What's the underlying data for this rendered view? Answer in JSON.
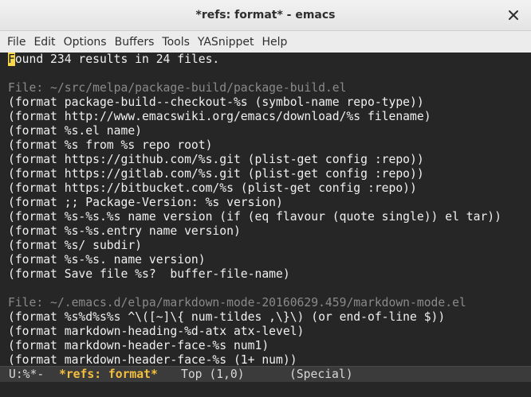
{
  "window": {
    "title": "*refs: format* - emacs"
  },
  "menu": [
    "File",
    "Edit",
    "Options",
    "Buffers",
    "Tools",
    "YASnippet",
    "Help"
  ],
  "buffer": {
    "summary_cursor_char": "F",
    "summary_rest": "ound 234 results in 24 files.",
    "groups": [
      {
        "file": "File: ~/src/melpa/package-build/package-build.el",
        "lines": [
          "(format package-build--checkout-%s (symbol-name repo-type))",
          "(format http://www.emacswiki.org/emacs/download/%s filename)",
          "(format %s.el name)",
          "(format %s from %s repo root)",
          "(format https://github.com/%s.git (plist-get config :repo))",
          "(format https://gitlab.com/%s.git (plist-get config :repo))",
          "(format https://bitbucket.com/%s (plist-get config :repo))",
          "(format ;; Package-Version: %s version)",
          "(format %s-%s.%s name version (if (eq flavour (quote single)) el tar))",
          "(format %s-%s.entry name version)",
          "(format %s/ subdir)",
          "(format %s-%s. name version)",
          "(format Save file %s?  buffer-file-name)"
        ]
      },
      {
        "file": "File: ~/.emacs.d/elpa/markdown-mode-20160629.459/markdown-mode.el",
        "lines": [
          "(format %s%d%s%s ^\\([~]\\{ num-tildes ,\\}\\) (or end-of-line $))",
          "(format markdown-heading-%d-atx atx-level)",
          "(format markdown-header-face-%s num1)",
          "(format markdown-header-face-%s (1+ num))"
        ]
      }
    ]
  },
  "modeline": {
    "status": "U:%*-",
    "buffer_name": "*refs: format*",
    "position": "Top (1,0)",
    "mode": "(Special)"
  }
}
